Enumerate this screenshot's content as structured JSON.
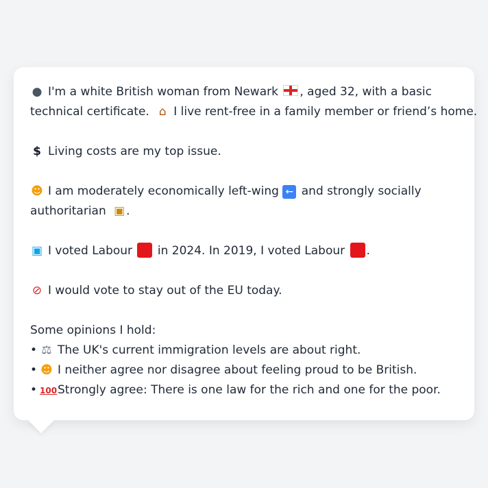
{
  "card": {
    "intro": {
      "line1_a": "I'm a white British woman from Newark",
      "line1_b": ", aged 32, with a basic",
      "line2_a": "technical certificate.",
      "line2_b": "I live rent-free in a family member or friend’s home."
    },
    "issue": "Living costs are my top issue.",
    "ideology": {
      "line1_a": "I am moderately economically left-wing",
      "line1_b": "and strongly socially",
      "line2_a": "authoritarian",
      "line2_b": "."
    },
    "vote": {
      "a": "I voted Labour",
      "b": "in 2024. In 2019, I voted Labour",
      "c": "."
    },
    "eu": "I would vote to stay out of the EU today.",
    "opinions_heading": "Some opinions I hold:",
    "opinions": [
      "The UK's current immigration levels are about right.",
      "I neither agree nor disagree about feeling proud to be British.",
      "Strongly agree: There is one law for the rich and one for the poor."
    ]
  },
  "icons": {
    "person": "person-icon",
    "flag": "england-flag-icon",
    "house": "house-icon",
    "dollar": "dollar-icon",
    "thinking": "thinking-face-icon",
    "arrow": "left-arrow-icon",
    "lock": "lock-icon",
    "ballot": "ballot-box-icon",
    "labour_color": "#e3161c",
    "no_entry": "no-entry-icon",
    "scales": "scales-icon",
    "hundred": "hundred-points-icon"
  }
}
